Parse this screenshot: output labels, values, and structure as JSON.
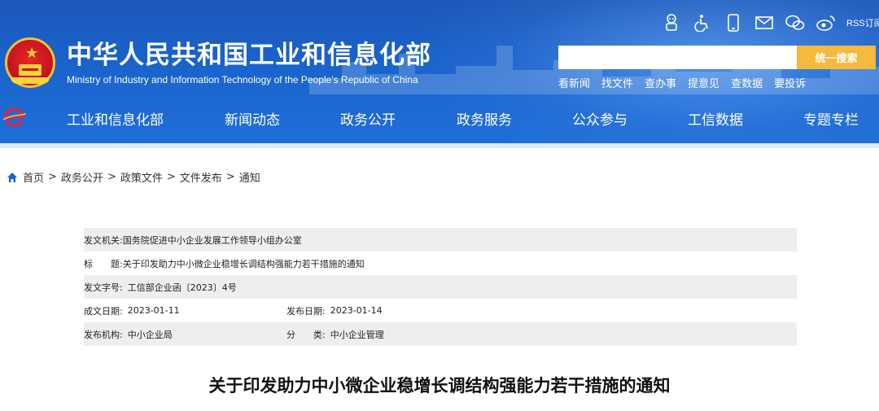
{
  "header": {
    "title": "中华人民共和国工业和信息化部",
    "subtitle": "Ministry of Industry and Information Technology of the People's Republic of China",
    "rss_label": "RSS订阅",
    "icons": [
      "robot-icon",
      "accessibility-icon",
      "mobile-icon",
      "mail-icon",
      "wechat-icon",
      "weibo-icon"
    ],
    "search": {
      "placeholder": "",
      "button_label": "统一搜索"
    },
    "quick_links": [
      "看新闻",
      "找文件",
      "查办事",
      "提意见",
      "查数据",
      "要投诉"
    ],
    "colors": {
      "header_blue": "#1a63cc",
      "search_button": "#f5b93e",
      "nav_logo_red": "#e8262b"
    }
  },
  "nav": {
    "items": [
      "工业和信息化部",
      "新闻动态",
      "政务公开",
      "政务服务",
      "公众参与",
      "工信数据",
      "专题专栏"
    ]
  },
  "breadcrumb": {
    "items": [
      "首页",
      "政务公开",
      "政策文件",
      "文件发布",
      "通知"
    ],
    "separator": ">"
  },
  "meta": {
    "issuer_label": "发文机关:",
    "issuer": "国务院促进中小企业发展工作领导小组办公室",
    "title_label_a": "标",
    "title_label_b": "题:",
    "title": "关于印发助力中小微企业稳增长调结构强能力若干措施的通知",
    "doc_no_label": "发文字号:",
    "doc_no": "工信部企业函〔2023〕4号",
    "created_label": "成文日期:",
    "created": "2023-01-11",
    "published_label": "发布日期:",
    "published": "2023-01-14",
    "org_label": "发布机构:",
    "org": "中小企业局",
    "category_label_a": "分",
    "category_label_b": "类:",
    "category": "中小企业管理"
  },
  "document": {
    "title": "关于印发助力中小微企业稳增长调结构强能力若干措施的通知"
  }
}
